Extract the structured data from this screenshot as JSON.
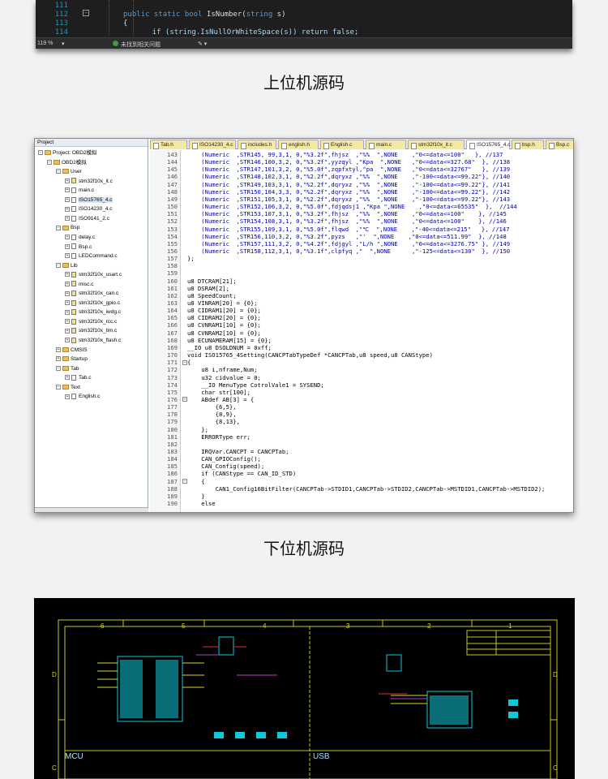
{
  "top_screenshot": {
    "lines": [
      {
        "num": "111",
        "code": ""
      },
      {
        "num": "112",
        "code_kw": "public static bool ",
        "code_rest": "IsNumber(",
        "code_ty": "string",
        "code_end": " s)"
      },
      {
        "num": "113",
        "code": "{"
      },
      {
        "num": "114",
        "code": "    if (string.IsNullOrWhiteSpace(s)) return false;"
      }
    ],
    "status": {
      "zoom": "119 %",
      "message": "未找到相关问题"
    }
  },
  "caption_upper": "上位机源码",
  "caption_lower": "下位机源码",
  "project_panel": {
    "header": "Project",
    "items": [
      "Project: OBD2模拟",
      "OBD2模拟",
      "User",
      "stm32f10x_it.c",
      "main.c",
      "ISO15765_4.c",
      "ISO14230_4.c",
      "ISO9141_2.c",
      "Bsp",
      "delay.c",
      "Bsp.c",
      "LEDCommand.c",
      "Lib",
      "stm32f10x_usart.c",
      "misc.c",
      "stm32f10x_can.c",
      "stm32f10x_gpio.c",
      "stm32f10x_iwdg.c",
      "stm32f10x_rcc.c",
      "stm32f10x_tim.c",
      "stm32f10x_flash.c",
      "CMSIS",
      "Startup",
      "Tab",
      "Tab.c",
      "Text",
      "English.c"
    ]
  },
  "tabs": [
    "Tab.h",
    "ISO14230_4.c",
    "includes.h",
    "english.h",
    "English.c",
    "main.c",
    "stm32f10x_it.c",
    "ISO15765_4.c",
    "bsp.h",
    "Bsp.c"
  ],
  "active_tab": "ISO15765_4.c",
  "code_lines": [
    {
      "n": "143",
      "t": "    (Numeric  ,STR145, 99,3,1, 0,\"%3.2f\",fhjsz  ,\"%%  \",NONE    ,\"0<=data<=100\"   }, //137"
    },
    {
      "n": "144",
      "t": "    (Numeric  ,STR146,100,3,2, 0,\"%3.2f\",yyzqyl ,\"Kpa  \",NONE   ,\"0<=data<=327.68\"  }, //138"
    },
    {
      "n": "145",
      "t": "    (Numeric  ,STR147,101,3,2, 0,\"%5.0f\",zqpfxtyl,\"pa  \",NONE   ,\"0<=data<=32767\"   }, //139"
    },
    {
      "n": "146",
      "t": "    (Numeric  ,STR148,102,3,1, 0,\"%2.2f\",dqryxz ,\"%%  \",NONE    ,\"-100<=data<=99.22\"}, //140"
    },
    {
      "n": "147",
      "t": "    (Numeric  ,STR149,103,3,1, 0,\"%2.2f\",dqryxz ,\"%%  \",NONE    ,\"-100<=data<=99.22\"}, //141"
    },
    {
      "n": "148",
      "t": "    (Numeric  ,STR150,104,3,3, 0,\"%2.2f\",dqryxz ,\"%%  \",NONE    ,\"-100<=data<=99.22\"}, //142"
    },
    {
      "n": "149",
      "t": "    (Numeric  ,STR151,105,3,1, 0,\"%2.2f\",dqryxz ,\"%%  \",NONE    ,\"-100<=data<=99.22\"}, //143"
    },
    {
      "n": "150",
      "t": "    (Numeric  ,STR152,106,3,2, 0,\"%5.0f\",fdjqdsj1 ,\"Kpa \",NONE    ,\"0<=data<=65535\"  },  //144"
    },
    {
      "n": "151",
      "t": "    (Numeric  ,STR153,107,3,1, 0,\"%3.2f\",fhjsz  ,\"%%  \",NONE    ,\"0<=data<=100\"    }, //145"
    },
    {
      "n": "152",
      "t": "    (Numeric  ,STR154,108,3,1, 0,\"%3.2f\",fhjsz  ,\"%%  \",NONE    ,\"0<=data<=100\"    }, //146"
    },
    {
      "n": "153",
      "t": "    (Numeric  ,STR155,109,3,1, 0,\"%5.0f\",flqwd  ,\"℃  \",NONE    ,\"-40<=data<=215\"   }, //147"
    },
    {
      "n": "154",
      "t": "    (Numeric  ,STR156,110,3,2, 0,\"%3.2f\",pyzs   ,\"'  \",NONE    ,\"0<=data<=511.99\"  }, //148"
    },
    {
      "n": "155",
      "t": "    (Numeric  ,STR157,111,3,2, 0,\"%4.2f\",fdjgyl ,\"L/h \",NONE    ,\"0<=data<=3276.75\" }, //149"
    },
    {
      "n": "156",
      "t": "    (Numeric  ,STR158,112,3,1, 0,\"%3.1f\",clpfyq ,\"  \",NONE      ,\"-125<=data<=130\"  }, //150"
    },
    {
      "n": "157",
      "t": "};"
    },
    {
      "n": "158",
      "t": ""
    },
    {
      "n": "159",
      "t": ""
    },
    {
      "n": "160",
      "t": "u8 DTCRAM[21];"
    },
    {
      "n": "161",
      "t": "u8 DSRAM[2];"
    },
    {
      "n": "162",
      "t": "u8 SpeedCount;"
    },
    {
      "n": "163",
      "t": "u8 VINRAM[20] = {0};"
    },
    {
      "n": "164",
      "t": "u8 CIDRAM1[20] = {0};"
    },
    {
      "n": "165",
      "t": "u8 CIDRAM2[20] = {0};"
    },
    {
      "n": "166",
      "t": "u8 CVNRAM1[10] = {0};"
    },
    {
      "n": "167",
      "t": "u8 CVNRAM2[10] = {0};"
    },
    {
      "n": "168",
      "t": "u8 ECUNAMERAM[15] = {0};"
    },
    {
      "n": "169",
      "t": "__IO u8 DSOLDNUM = 0xff;"
    },
    {
      "n": "170",
      "t": "void ISO15765_4Setting(CANCPTabTypeDef *CANCPTab,u8 speed,u8 CANStype)"
    },
    {
      "n": "171",
      "t": "{"
    },
    {
      "n": "172",
      "t": "    u8 i,nframe,Num;"
    },
    {
      "n": "173",
      "t": "    u32 cidvalue = 0;"
    },
    {
      "n": "174",
      "t": "    __IO MenuType CotrolVale1 = SYSEND;"
    },
    {
      "n": "175",
      "t": "    char str[100];"
    },
    {
      "n": "176",
      "t": "    ABdef AB[3] = {"
    },
    {
      "n": "177",
      "t": "        {6,5},"
    },
    {
      "n": "178",
      "t": "        {8,9},"
    },
    {
      "n": "179",
      "t": "        {8,13},"
    },
    {
      "n": "180",
      "t": "    };"
    },
    {
      "n": "181",
      "t": "    ERRORType err;"
    },
    {
      "n": "182",
      "t": ""
    },
    {
      "n": "183",
      "t": "    IRQVar.CANCPT = CANCPTab;"
    },
    {
      "n": "184",
      "t": "    CAN_GPIOConfig();"
    },
    {
      "n": "185",
      "t": "    CAN_Config(speed);"
    },
    {
      "n": "186",
      "t": "    if (CANStype == CAN_ID_STD)"
    },
    {
      "n": "187",
      "t": "    {"
    },
    {
      "n": "188",
      "t": "        CAN1_Config16BitFilter(CANCPTab->STDID1,CANCPTab->STDID2,CANCPTab->MSTDID1,CANCPTab->MSTDID2);"
    },
    {
      "n": "189",
      "t": "    }"
    },
    {
      "n": "190",
      "t": "    else"
    }
  ],
  "schematic": {
    "columns": [
      "6",
      "5",
      "4",
      "3",
      "2",
      "1"
    ],
    "rows": [
      "D",
      "C"
    ],
    "regions": [
      "MCU",
      "USB"
    ]
  },
  "colors": {
    "vs_bg": "#1e1e1e",
    "keil_tab": "#f4e7a0",
    "schematic_bg": "#000000",
    "schematic_line": "#d8d820",
    "schematic_part": "#00c8d8"
  }
}
